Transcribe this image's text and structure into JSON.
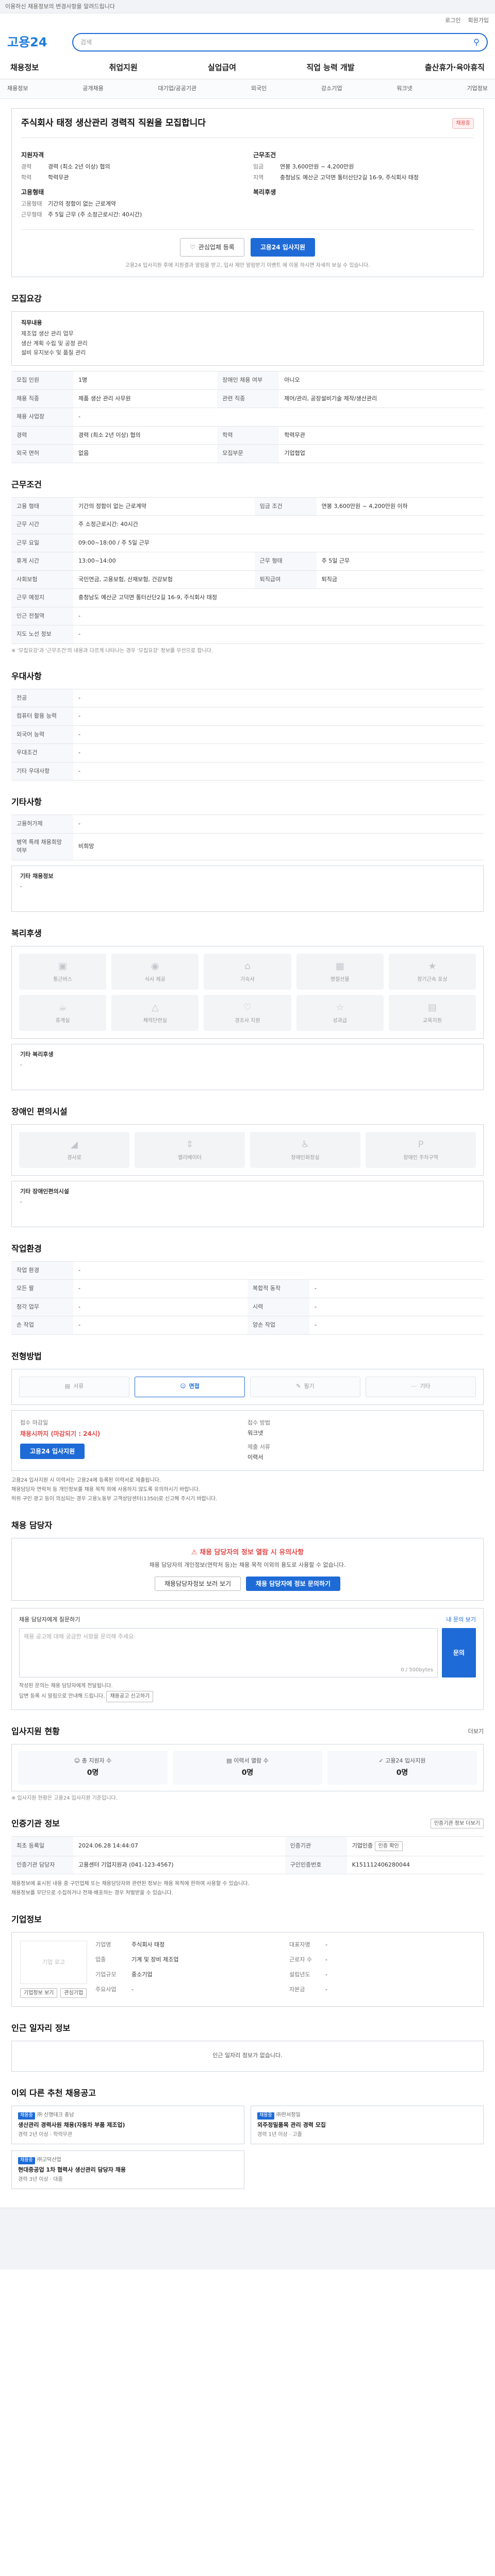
{
  "top_notice": "이용하신 채용정보의 변경사항을 알려드립니다",
  "util": {
    "items": [
      "로그인",
      "회원가입"
    ]
  },
  "header": {
    "logo_a": "고용",
    "logo_b": "24",
    "search_placeholder": "검색",
    "search_icon": "search-icon"
  },
  "gnb": [
    "채용정보",
    "취업지원",
    "실업급여",
    "직업 능력 개발",
    "출산휴가·육아휴직"
  ],
  "subnav": [
    "채용정보",
    "공개채용",
    "대기업/공공기관",
    "외국인",
    "강소기업",
    "워크넷",
    "기업정보"
  ],
  "job": {
    "title": "주식회사 태정 생산관리 경력직 직원을 모집합니다",
    "badge": "채용중",
    "apply_head": "지원자격",
    "apply": [
      {
        "k": "경력",
        "v": "경력 (최소 2년 이상) 협의"
      },
      {
        "k": "학력",
        "v": "학력무관"
      }
    ],
    "cond_head": "근무조건",
    "cond": [
      {
        "k": "임금",
        "v": "연봉 3,600만원 ~ 4,200만원"
      },
      {
        "k": "지역",
        "v": "충청남도 예산군 고덕면 통터산단2길 16-9, 주식회사 태정"
      }
    ],
    "emp_head": "고용형태",
    "emp": [
      {
        "k": "고용형태",
        "v": "기간의 정함이 없는 근로계약"
      },
      {
        "k": "근무형태",
        "v": "주 5일 근무 (주 소정근로시간: 40시간)"
      }
    ],
    "welfare_head": "복리후생",
    "btn_scrap": "관심업체 등록",
    "btn_apply": "고용24 입사지원",
    "note": "고용24 입사지원 후에 지원결과 알림을 받고, 입사 제안 알림받기 이벤트 에 이용 하시면 자세히 보실 수 있습니다."
  },
  "sections": {
    "recruit": "모집요강",
    "conditions": "근무조건",
    "prefer": "우대사항",
    "other": "기타사항",
    "welfare": "복리후생",
    "accessibility": "장애인 편의시설",
    "workplace": "작업환경",
    "process": "전형방법",
    "contact": "채용 담당자",
    "stats": "입사지원 현황",
    "info": "인증기관 정보",
    "company": "기업정보",
    "others": "인근 일자리 정보",
    "more": "이외 다른 추천 채용공고"
  },
  "recruit": {
    "intro_head": "직무내용",
    "intro": [
      "제조업 생산 관리 업무",
      "생산 계획 수립 및 공정 관리",
      "설비 유지보수 및 품질 관리"
    ],
    "rows": [
      [
        "모집 인원",
        "1명",
        "장애인 채용 여부",
        "아니오"
      ],
      [
        "채용 직종",
        "제품 생산 관리 사무원",
        "관련 직종",
        "제어/관리, 공장설비기술 제작/생산관리"
      ],
      [
        "채용 사업장",
        "-",
        "",
        ""
      ],
      [
        "경력",
        "경력 (최소 2년 이상) 협의",
        "학력",
        "학력무관"
      ],
      [
        "외국 면허",
        "없음",
        "모집부문",
        "기업협업"
      ]
    ]
  },
  "conditions": {
    "rows": [
      [
        "고용 형태",
        "기간의 정함이 없는 근로계약",
        "임금 조건",
        "연봉 3,600만원 ~ 4,200만원 이하"
      ],
      [
        "근무 시간",
        "주 소정근로시간: 40시간",
        "",
        ""
      ],
      [
        "근무 요일",
        "09:00~18:00 / 주 5일 근무",
        "",
        ""
      ],
      [
        "휴게 시간",
        "13:00~14:00",
        "근무 형태",
        "주 5일 근무"
      ],
      [
        "사회보험",
        "국민연금, 고용보험, 산재보험, 건강보험",
        "퇴직급여",
        "퇴직금"
      ],
      [
        "근무 예정지",
        "충청남도 예산군 고덕면 통터산단2길 16-9, 주식회사 태정",
        "",
        ""
      ],
      [
        "인근 전철역",
        "-",
        "",
        ""
      ],
      [
        "지도 노선 정보",
        "-",
        "",
        ""
      ]
    ],
    "note": "※ '모집요강'과 '근무조건'의 내용과 다르게 나타나는 경우 '모집요강' 정보를 우선으로 합니다."
  },
  "prefer": {
    "rows": [
      [
        "전공",
        "-"
      ],
      [
        "컴퓨터 활용 능력",
        "-"
      ],
      [
        "외국어 능력",
        "-"
      ],
      [
        "우대조건",
        "-"
      ],
      [
        "기타 우대사항",
        "-"
      ]
    ]
  },
  "other": {
    "rows": [
      [
        "고용허가제",
        "-"
      ],
      [
        "병역 특례 채용희망 여부",
        "비희망"
      ]
    ],
    "free_label": "기타 채용정보",
    "free_value": "-"
  },
  "welfare": {
    "items": [
      {
        "icon": "bus-icon",
        "label": "통근버스"
      },
      {
        "icon": "meal-icon",
        "label": "식사 제공"
      },
      {
        "icon": "home-icon",
        "label": "기숙사"
      },
      {
        "icon": "gift-icon",
        "label": "명절선물"
      },
      {
        "icon": "medal-icon",
        "label": "장기근속 포상"
      },
      {
        "icon": "coffee-icon",
        "label": "휴게실"
      },
      {
        "icon": "gym-icon",
        "label": "체력단련실"
      },
      {
        "icon": "heart-icon",
        "label": "경조사 지원"
      },
      {
        "icon": "star-icon",
        "label": "성과급"
      },
      {
        "icon": "book-icon",
        "label": "교육지원"
      }
    ],
    "extra_label": "기타 복리후생",
    "extra_value": "-"
  },
  "access": {
    "items": [
      {
        "icon": "ramp-icon",
        "label": "경사로"
      },
      {
        "icon": "elevator-icon",
        "label": "엘리베이터"
      },
      {
        "icon": "toilet-icon",
        "label": "장애인화장실"
      },
      {
        "icon": "parking-icon",
        "label": "장애인 주차구역"
      }
    ],
    "extra_label": "기타 장애인편의시설",
    "extra_value": "-"
  },
  "workplace": {
    "rows": [
      [
        "작업 환경",
        "-",
        "",
        ""
      ],
      [
        "모든 팔",
        "-",
        "복합적 동작",
        "-"
      ],
      [
        "청각 업무",
        "-",
        "시력",
        "-"
      ],
      [
        "손 작업",
        "-",
        "양손 작업",
        "-"
      ]
    ]
  },
  "process": {
    "steps": [
      {
        "icon": "doc-icon",
        "label": "서류"
      },
      {
        "icon": "person-icon",
        "label": "면접"
      },
      {
        "icon": "pen-icon",
        "label": "필기"
      },
      {
        "icon": "dots-icon",
        "label": "기타"
      }
    ],
    "active": 1,
    "deadline_h": "접수 마감일",
    "deadline_v": "채용시까지 (마감되기 : 24시)",
    "method_h": "접수 방법",
    "method_v": "워크넷",
    "apply_btn": "고용24 입사지원",
    "doc_h": "제출 서류",
    "doc_v": "이력서",
    "notes": [
      "고용24 입사지원 시 이력서는 고용24에 등록된 이력서로 제출됩니다.",
      "채용담당자 연락처 등 개인정보를 채용 목적 외에 사용하지 않도록 유의하시기 바랍니다.",
      "허위 구인 광고 등이 의심되는 경우 고용노동부 고객상담센터(1350)로 신고해 주시기 바랍니다."
    ]
  },
  "contact": {
    "warn_title": "채용 담당자의 정보 열람 시 유의사항",
    "warn_text": "채용 담당자의 개인정보(연락처 등)는 채용 목적 이외의 용도로 사용할 수 없습니다.",
    "btn_a": "채용담당자정보 보러 보기",
    "btn_b": "채용 담당자에 정보 문의하기",
    "q_label": "채용 담당자에게 질문하기",
    "q_guide": "내 문의 보기",
    "q_placeholder": "채용 공고에 대해 궁금한 사항을 문의해 주세요.",
    "q_count": "0 / 500bytes",
    "q_submit": "문의",
    "notes": [
      "작성된 문의는 채용 담당자에게 전달됩니다.",
      "답변 등록 시 알림으로 안내해 드립니다."
    ],
    "inline_btn": "채용공고 신고하기"
  },
  "stats": {
    "head_btn": "더보기",
    "items": [
      {
        "icon": "user-icon",
        "label": "총 지원자 수",
        "value": "0명"
      },
      {
        "icon": "doc-icon",
        "label": "이력서 열람 수",
        "value": "0명"
      },
      {
        "icon": "click-icon",
        "label": "고용24 입사지원",
        "value": "0명"
      }
    ],
    "note": "※ 입사지원 현황은 고용24 입사지원 기준입니다."
  },
  "info": {
    "btn": "인증기관 정보 더보기",
    "rows": [
      [
        "최초 등록일",
        "2024.06.28 14:44:07",
        "인증기관",
        "기업인증",
        "인증 확인"
      ],
      [
        "인증기관 담당자",
        "고용센터 기업지원과 (041-123-4567)",
        "구인인증번호",
        "K151112406280044"
      ]
    ],
    "notes": [
      "채용정보에 표시된 내용 중 구인업체 또는 채용담당자와 관련된 정보는 채용 목적에 한하여 사용할 수 있습니다.",
      "채용정보를 무단으로 수집하거나 전재·배포하는 경우 처벌받을 수 있습니다."
    ]
  },
  "company": {
    "logo": "기업 로고",
    "rows": [
      [
        "기업명",
        "주식회사 태정",
        "대표자명",
        "-"
      ],
      [
        "업종",
        "기계 및 장비 제조업",
        "근로자 수",
        "-"
      ],
      [
        "기업규모",
        "중소기업",
        "설립년도",
        "-"
      ],
      [
        "주요사업",
        "-",
        "자본금",
        "-"
      ]
    ],
    "btn_a": "기업정보 보기",
    "btn_b": "관심기업"
  },
  "nearby": {
    "empty": "인근 일자리 정보가 없습니다."
  },
  "more": {
    "cards": [
      {
        "co": "㈜ 신명테크 충남",
        "title": "생산관리 경력사원 채용(자동차 부품 제조업)",
        "foot": "경력 2년 이상 · 학력무관"
      },
      {
        "co": "㈜한서정밀",
        "title": "외주정밀품목 관리 경력 모집",
        "foot": "경력 1년 이상 · 고졸"
      },
      {
        "co": "㈜고덕산업",
        "title": "현대중공업 1차 협력사 생산관리 담당자 채용",
        "foot": "경력 3년 이상 · 대졸"
      }
    ]
  }
}
